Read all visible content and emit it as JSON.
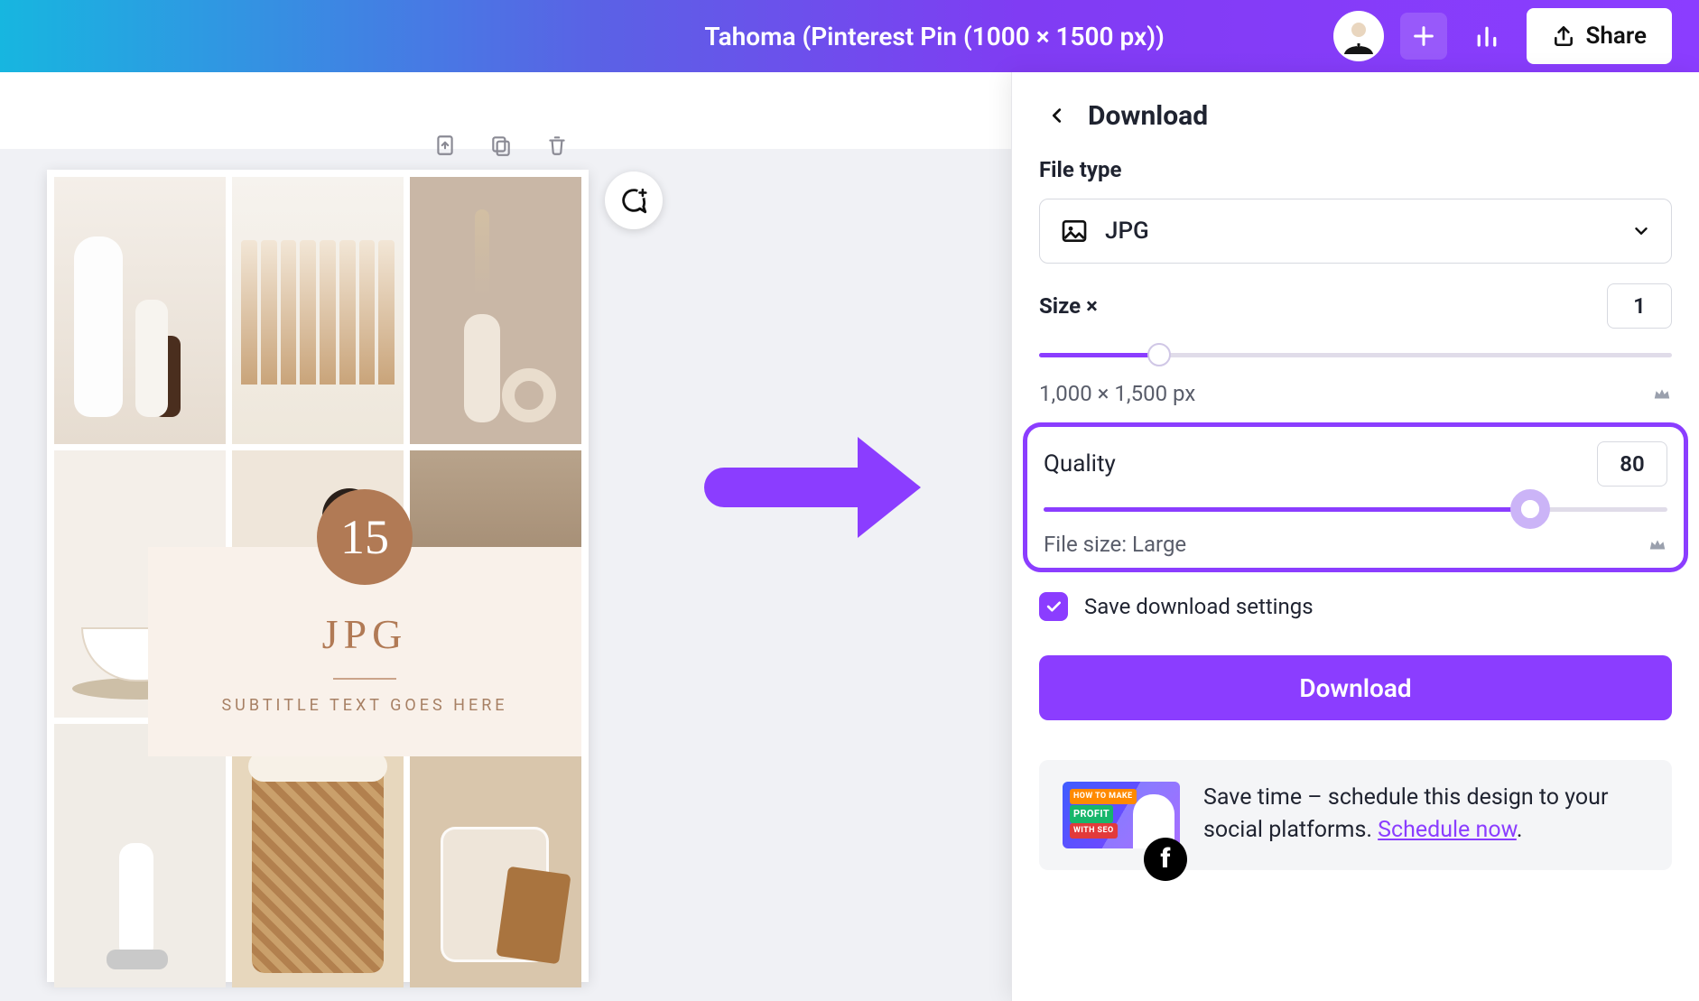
{
  "header": {
    "doc_title": "Tahoma (Pinterest Pin (1000 × 1500 px))",
    "share_label": "Share"
  },
  "design": {
    "badge_number": "15",
    "title": "JPG",
    "subtitle": "SUBTITLE TEXT GOES HERE"
  },
  "panel": {
    "title": "Download",
    "file_type_label": "File type",
    "file_type_value": "JPG",
    "size_label": "Size ×",
    "size_value": "1",
    "size_slider_percent": 19,
    "dimensions_text": "1,000 × 1,500 px",
    "quality_label": "Quality",
    "quality_value": "80",
    "quality_slider_percent": 78,
    "file_size_text": "File size: Large",
    "save_settings_label": "Save download settings",
    "save_settings_checked": true,
    "download_button": "Download",
    "promo_text_a": "Save time – schedule this design to your social platforms. ",
    "promo_link": "Schedule now",
    "promo_text_b": ".",
    "promo_thumb_tag_a": "HOW TO MAKE",
    "promo_thumb_tag_b": "PROFIT",
    "promo_thumb_tag_c": "WITH SEO"
  }
}
